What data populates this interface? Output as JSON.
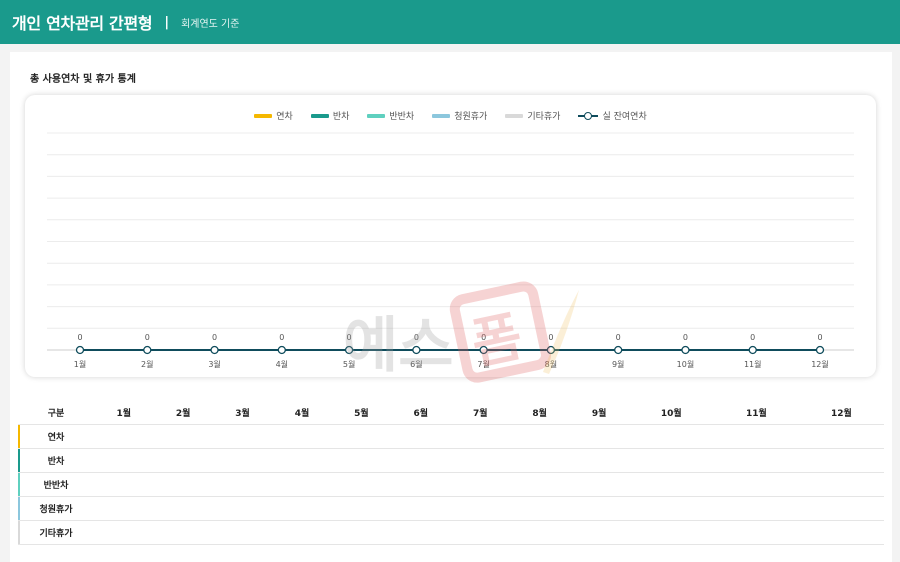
{
  "header": {
    "title": "개인 연차관리 간편형",
    "separator": "|",
    "subtitle": "회계연도 기준"
  },
  "section": {
    "title": "총 사용연차 및 휴가 통계"
  },
  "legend": [
    {
      "label": "연차",
      "color": "#f5b800",
      "kind": "bar"
    },
    {
      "label": "반차",
      "color": "#1a9a8c",
      "kind": "bar"
    },
    {
      "label": "반반차",
      "color": "#5fd0bf",
      "kind": "bar"
    },
    {
      "label": "청원휴가",
      "color": "#8cc7dd",
      "kind": "bar"
    },
    {
      "label": "기타휴가",
      "color": "#d9d9d9",
      "kind": "bar"
    },
    {
      "label": "실 잔여연차",
      "color": "#0f4c5c",
      "kind": "line"
    }
  ],
  "watermark": {
    "text": "예스폼"
  },
  "chart_data": {
    "type": "bar",
    "categories": [
      "1월",
      "2월",
      "3월",
      "4월",
      "5월",
      "6월",
      "7월",
      "8월",
      "9월",
      "10월",
      "11월",
      "12월"
    ],
    "series": [
      {
        "name": "연차",
        "values": [
          0,
          0,
          0,
          0,
          0,
          0,
          0,
          0,
          0,
          0,
          0,
          0
        ]
      },
      {
        "name": "반차",
        "values": [
          0,
          0,
          0,
          0,
          0,
          0,
          0,
          0,
          0,
          0,
          0,
          0
        ]
      },
      {
        "name": "반반차",
        "values": [
          0,
          0,
          0,
          0,
          0,
          0,
          0,
          0,
          0,
          0,
          0,
          0
        ]
      },
      {
        "name": "청원휴가",
        "values": [
          0,
          0,
          0,
          0,
          0,
          0,
          0,
          0,
          0,
          0,
          0,
          0
        ]
      },
      {
        "name": "기타휴가",
        "values": [
          0,
          0,
          0,
          0,
          0,
          0,
          0,
          0,
          0,
          0,
          0,
          0
        ]
      },
      {
        "name": "실 잔여연차",
        "type": "line",
        "values": [
          0,
          0,
          0,
          0,
          0,
          0,
          0,
          0,
          0,
          0,
          0,
          0
        ]
      }
    ],
    "data_labels": [
      "0",
      "0",
      "0",
      "0",
      "0",
      "0",
      "0",
      "0",
      "0",
      "0",
      "0",
      "0"
    ],
    "ylim": [
      0,
      10
    ],
    "grid": true,
    "legend_position": "top-center"
  },
  "table": {
    "corner_label": "구분",
    "months": [
      "1월",
      "2월",
      "3월",
      "4월",
      "5월",
      "6월",
      "7월",
      "8월",
      "9월",
      "10월",
      "11월",
      "12월"
    ],
    "rows": [
      {
        "label": "연차",
        "color": "#f5b800",
        "values": [
          "",
          "",
          "",
          "",
          "",
          "",
          "",
          "",
          "",
          "",
          "",
          ""
        ]
      },
      {
        "label": "반차",
        "color": "#1a9a8c",
        "values": [
          "",
          "",
          "",
          "",
          "",
          "",
          "",
          "",
          "",
          "",
          "",
          ""
        ]
      },
      {
        "label": "반반차",
        "color": "#5fd0bf",
        "values": [
          "",
          "",
          "",
          "",
          "",
          "",
          "",
          "",
          "",
          "",
          "",
          ""
        ]
      },
      {
        "label": "청원휴가",
        "color": "#8cc7dd",
        "values": [
          "",
          "",
          "",
          "",
          "",
          "",
          "",
          "",
          "",
          "",
          "",
          ""
        ]
      },
      {
        "label": "기타휴가",
        "color": "#d9d9d9",
        "values": [
          "",
          "",
          "",
          "",
          "",
          "",
          "",
          "",
          "",
          "",
          "",
          ""
        ]
      }
    ]
  }
}
